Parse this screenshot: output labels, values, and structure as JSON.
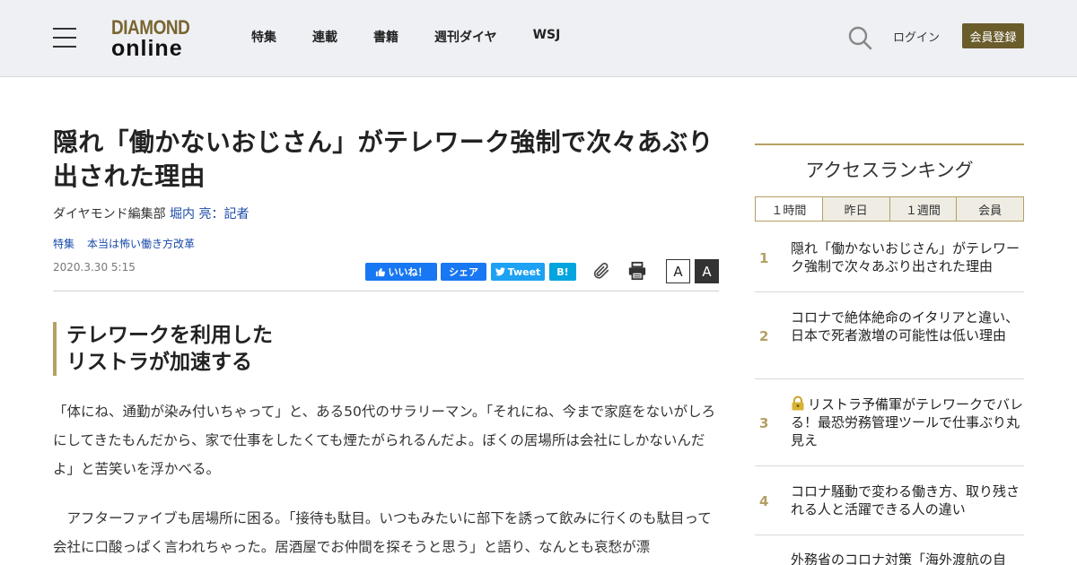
{
  "header": {
    "logo_top": "DIAMOND",
    "logo_bottom": "online",
    "nav": [
      "特集",
      "連載",
      "書籍",
      "週刊ダイヤ",
      "WSJ"
    ],
    "login": "ログイン",
    "register": "会員登録"
  },
  "article": {
    "title": "隠れ「働かないおじさん」がテレワーク強制で次々あぶり出された理由",
    "byline_prefix": "ダイヤモンド編集部",
    "author": "堀内 亮：記者",
    "tags": [
      "特集",
      "本当は怖い働き方改革"
    ],
    "date": "2020.3.30 5:15",
    "share": {
      "like": "いいね！",
      "share": "シェア",
      "tweet": "Tweet",
      "hatena": "B!"
    },
    "font_small": "A",
    "font_large": "A",
    "subhead_line1": "テレワークを利用した",
    "subhead_line2": "リストラが加速する",
    "paragraphs": [
      "「体にね、通勤が染み付いちゃって」と、ある50代のサラリーマン。「それにね、今まで家庭をないがしろにしてきたもんだから、家で仕事をしたくても煙たがられるんだよ。ぼくの居場所は会社にしかないんだよ」と苦笑いを浮かべる。",
      "　アフターファイブも居場所に困る。「接待も駄目。いつもみたいに部下を誘って飲みに行くのも駄目って会社に口酸っぱく言われちゃった。居酒屋でお仲間を探そうと思う」と語り、なんとも哀愁が漂"
    ]
  },
  "sidebar": {
    "ranking_title": "アクセスランキング",
    "tabs": [
      "１時間",
      "昨日",
      "１週間",
      "会員"
    ],
    "active_tab": "１時間",
    "items": [
      {
        "rank": "1",
        "text": "隠れ「働かないおじさん」がテレワーク強制で次々あぶり出された理由",
        "locked": false
      },
      {
        "rank": "2",
        "text": "コロナで絶体絶命のイタリアと違い、日本で死者激増の可能性は低い理由",
        "locked": false
      },
      {
        "rank": "3",
        "text": "リストラ予備軍がテレワークでバレる！最恐労務管理ツールで仕事ぶり丸見え",
        "locked": true
      },
      {
        "rank": "4",
        "text": "コロナ騒動で変わる働き方、取り残される人と活躍できる人の違い",
        "locked": false
      },
      {
        "rank": "5",
        "text": "外務省のコロナ対策「海外渡航の自",
        "locked": false
      }
    ]
  },
  "colors": {
    "accent_gold": "#b3a063",
    "register_bg": "#6b5c2c",
    "link_blue": "#1a4aa8",
    "facebook": "#1877f2",
    "twitter": "#1da1f2",
    "hatena": "#00a4de"
  },
  "icons": [
    "hamburger-menu-icon",
    "search-icon",
    "paperclip-icon",
    "printer-icon",
    "lock-icon"
  ]
}
